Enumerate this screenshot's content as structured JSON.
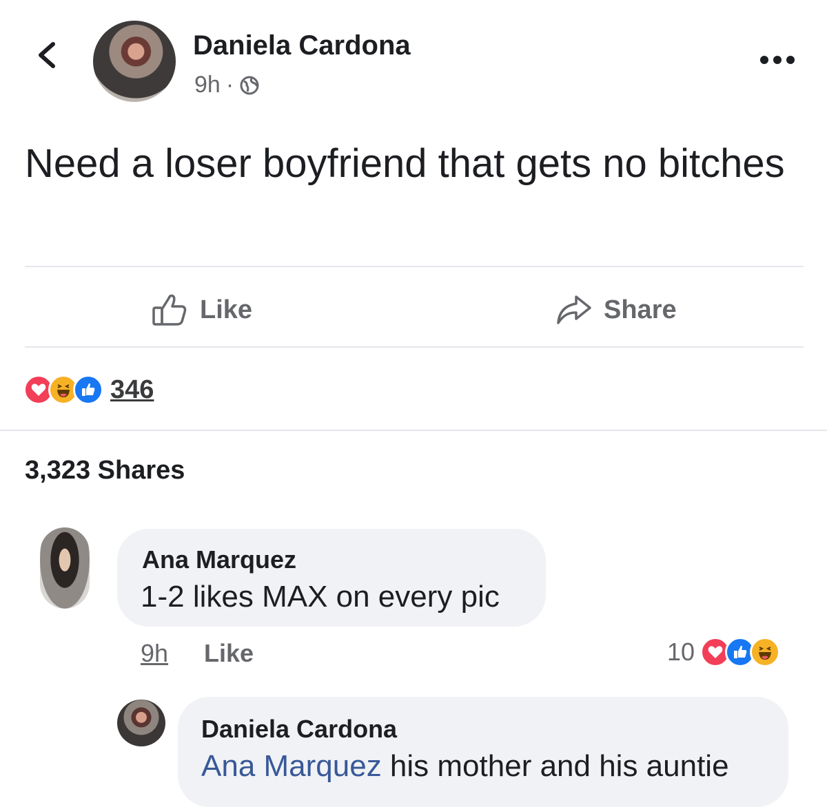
{
  "post": {
    "author": "Daniela Cardona",
    "time": "9h",
    "meta_separator": "·",
    "privacy_icon": "globe-icon",
    "text": "Need a loser boyfriend that gets no bitches",
    "actions": {
      "like_label": "Like",
      "share_label": "Share"
    },
    "reaction_count": "346",
    "reaction_icons": [
      "love",
      "haha",
      "like"
    ],
    "shares_label": "3,323 Shares"
  },
  "comments": [
    {
      "author": "Ana Marquez",
      "text": "1-2 likes MAX on every pic",
      "time": "9h",
      "like_label": "Like",
      "reaction_count": "10",
      "reaction_icons": [
        "love",
        "like",
        "haha"
      ]
    }
  ],
  "reply": {
    "author": "Daniela Cardona",
    "mention": "Ana Marquez",
    "text": " his mother and his auntie"
  },
  "colors": {
    "text": "#1c1e21",
    "secondary": "#65676b",
    "bubble": "#f0f2f5",
    "mention": "#385898",
    "love": "#f33e58",
    "haha": "#f7b125",
    "like": "#1877f2"
  }
}
